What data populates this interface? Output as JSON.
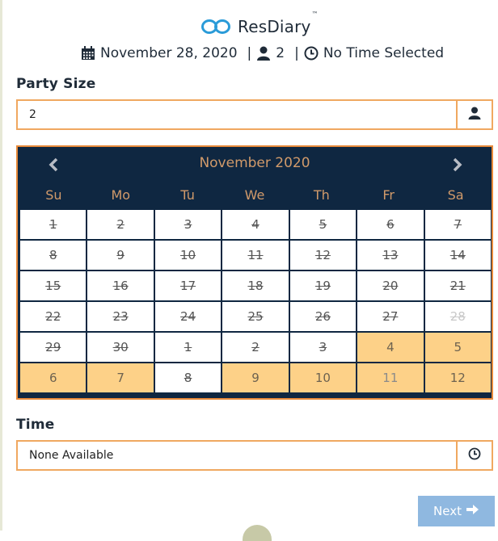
{
  "brand": {
    "name": "ResDiary",
    "tm": "™",
    "logo_icon": "infinity-icon",
    "logo_color": "#2a9bd8"
  },
  "summary": {
    "date": "November 28, 2020",
    "party": "2",
    "time": "No Time Selected",
    "separator": "|",
    "icons": [
      "calendar-icon",
      "person-icon",
      "clock-icon"
    ]
  },
  "party_size": {
    "label": "Party Size",
    "value": "2",
    "addon_icon": "person-icon"
  },
  "calendar": {
    "month_label": "November 2020",
    "prev_icon": "chevron-left-icon",
    "next_icon": "chevron-right-icon",
    "weekdays": [
      "Su",
      "Mo",
      "Tu",
      "We",
      "Th",
      "Fr",
      "Sa"
    ],
    "days": [
      {
        "label": "1",
        "state": "disabled"
      },
      {
        "label": "2",
        "state": "disabled"
      },
      {
        "label": "3",
        "state": "disabled"
      },
      {
        "label": "4",
        "state": "disabled"
      },
      {
        "label": "5",
        "state": "disabled"
      },
      {
        "label": "6",
        "state": "disabled"
      },
      {
        "label": "7",
        "state": "disabled"
      },
      {
        "label": "8",
        "state": "disabled"
      },
      {
        "label": "9",
        "state": "disabled"
      },
      {
        "label": "10",
        "state": "disabled"
      },
      {
        "label": "11",
        "state": "disabled"
      },
      {
        "label": "12",
        "state": "disabled"
      },
      {
        "label": "13",
        "state": "disabled"
      },
      {
        "label": "14",
        "state": "disabled"
      },
      {
        "label": "15",
        "state": "disabled"
      },
      {
        "label": "16",
        "state": "disabled"
      },
      {
        "label": "17",
        "state": "disabled"
      },
      {
        "label": "18",
        "state": "disabled"
      },
      {
        "label": "19",
        "state": "disabled"
      },
      {
        "label": "20",
        "state": "disabled"
      },
      {
        "label": "21",
        "state": "disabled"
      },
      {
        "label": "22",
        "state": "disabled"
      },
      {
        "label": "23",
        "state": "disabled"
      },
      {
        "label": "24",
        "state": "disabled"
      },
      {
        "label": "25",
        "state": "disabled"
      },
      {
        "label": "26",
        "state": "disabled"
      },
      {
        "label": "27",
        "state": "disabled"
      },
      {
        "label": "28",
        "state": "selected-faded"
      },
      {
        "label": "29",
        "state": "disabled"
      },
      {
        "label": "30",
        "state": "disabled"
      },
      {
        "label": "1",
        "state": "disabled"
      },
      {
        "label": "2",
        "state": "disabled"
      },
      {
        "label": "3",
        "state": "disabled"
      },
      {
        "label": "4",
        "state": "available"
      },
      {
        "label": "5",
        "state": "available"
      },
      {
        "label": "6",
        "state": "available"
      },
      {
        "label": "7",
        "state": "available"
      },
      {
        "label": "8",
        "state": "disabled"
      },
      {
        "label": "9",
        "state": "available"
      },
      {
        "label": "10",
        "state": "available"
      },
      {
        "label": "11",
        "state": "available-dim"
      },
      {
        "label": "12",
        "state": "available"
      }
    ]
  },
  "time": {
    "label": "Time",
    "value": "None Available",
    "addon_icon": "clock-icon"
  },
  "next_button": {
    "label": "Next",
    "icon": "arrow-right-icon"
  },
  "colors": {
    "accent_orange": "#f0a860",
    "calendar_bg": "#0f2741",
    "calendar_text": "#d19a6a",
    "available_day": "#fdd188",
    "next_button": "#8fb8e0"
  }
}
